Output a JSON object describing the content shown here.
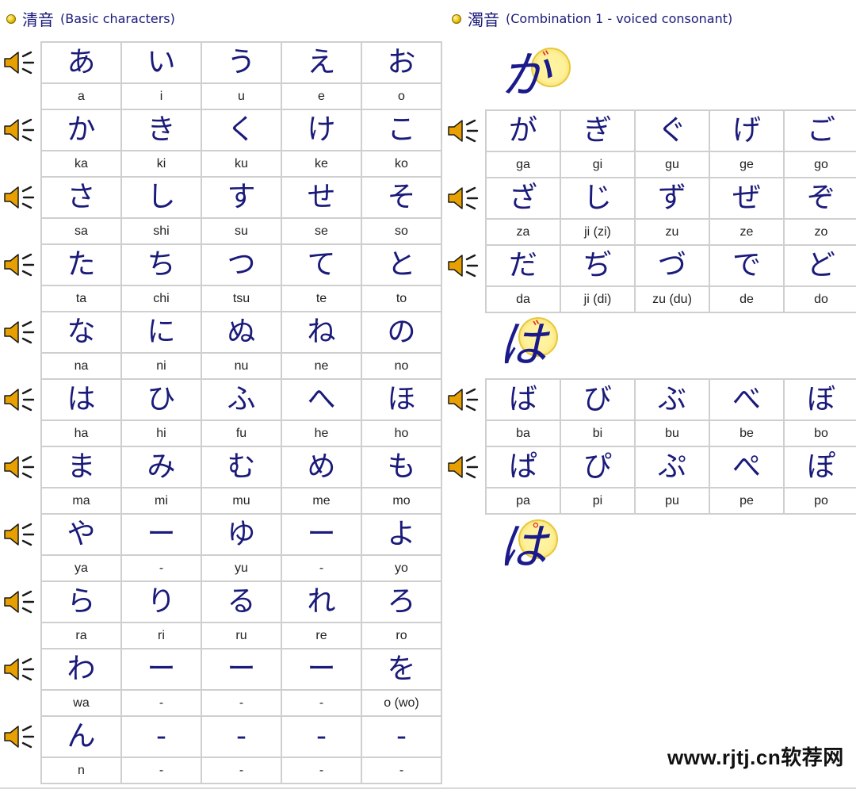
{
  "left_header": {
    "kana": "清音",
    "note": "(Basic characters)"
  },
  "right_header": {
    "kana": "濁音",
    "note": "(Combination 1 - voiced consonant)"
  },
  "basic_rows": [
    {
      "kana": [
        "あ",
        "い",
        "う",
        "え",
        "お"
      ],
      "romaji": [
        "a",
        "i",
        "u",
        "e",
        "o"
      ]
    },
    {
      "kana": [
        "か",
        "き",
        "く",
        "け",
        "こ"
      ],
      "romaji": [
        "ka",
        "ki",
        "ku",
        "ke",
        "ko"
      ]
    },
    {
      "kana": [
        "さ",
        "し",
        "す",
        "せ",
        "そ"
      ],
      "romaji": [
        "sa",
        "shi",
        "su",
        "se",
        "so"
      ]
    },
    {
      "kana": [
        "た",
        "ち",
        "つ",
        "て",
        "と"
      ],
      "romaji": [
        "ta",
        "chi",
        "tsu",
        "te",
        "to"
      ]
    },
    {
      "kana": [
        "な",
        "に",
        "ぬ",
        "ね",
        "の"
      ],
      "romaji": [
        "na",
        "ni",
        "nu",
        "ne",
        "no"
      ]
    },
    {
      "kana": [
        "は",
        "ひ",
        "ふ",
        "へ",
        "ほ"
      ],
      "romaji": [
        "ha",
        "hi",
        "fu",
        "he",
        "ho"
      ]
    },
    {
      "kana": [
        "ま",
        "み",
        "む",
        "め",
        "も"
      ],
      "romaji": [
        "ma",
        "mi",
        "mu",
        "me",
        "mo"
      ]
    },
    {
      "kana": [
        "や",
        "ー",
        "ゆ",
        "ー",
        "よ"
      ],
      "romaji": [
        "ya",
        "-",
        "yu",
        "-",
        "yo"
      ]
    },
    {
      "kana": [
        "ら",
        "り",
        "る",
        "れ",
        "ろ"
      ],
      "romaji": [
        "ra",
        "ri",
        "ru",
        "re",
        "ro"
      ]
    },
    {
      "kana": [
        "わ",
        "ー",
        "ー",
        "ー",
        "を"
      ],
      "romaji": [
        "wa",
        "-",
        "-",
        "-",
        "o (wo)"
      ]
    },
    {
      "kana": [
        "ん",
        "-",
        "-",
        "-",
        "-"
      ],
      "romaji": [
        "n",
        "-",
        "-",
        "-",
        "-"
      ]
    }
  ],
  "voiced_rows_1": [
    {
      "kana": [
        "が",
        "ぎ",
        "ぐ",
        "げ",
        "ご"
      ],
      "romaji": [
        "ga",
        "gi",
        "gu",
        "ge",
        "go"
      ]
    },
    {
      "kana": [
        "ざ",
        "じ",
        "ず",
        "ぜ",
        "ぞ"
      ],
      "romaji": [
        "za",
        "ji (zi)",
        "zu",
        "ze",
        "zo"
      ]
    },
    {
      "kana": [
        "だ",
        "ぢ",
        "づ",
        "で",
        "ど"
      ],
      "romaji": [
        "da",
        "ji (di)",
        "zu (du)",
        "de",
        "do"
      ]
    }
  ],
  "voiced_rows_2": [
    {
      "kana": [
        "ば",
        "び",
        "ぶ",
        "べ",
        "ぼ"
      ],
      "romaji": [
        "ba",
        "bi",
        "bu",
        "be",
        "bo"
      ]
    },
    {
      "kana": [
        "ぱ",
        "ぴ",
        "ぷ",
        "ぺ",
        "ぽ"
      ],
      "romaji": [
        "pa",
        "pi",
        "pu",
        "pe",
        "po"
      ]
    }
  ],
  "decorations": [
    {
      "base": "か",
      "mark": "゛"
    },
    {
      "base": "は",
      "mark": "゛"
    },
    {
      "base": "は",
      "mark": "゜"
    }
  ],
  "icons": {
    "speaker": "speaker-icon",
    "bullet": "bullet-icon"
  },
  "colors": {
    "kana": "#1a1a7a",
    "border": "#cfcfcf",
    "speaker": "#e8a000",
    "circle": "#fff09a"
  },
  "watermark": "www.rjtj.cn软荐网"
}
